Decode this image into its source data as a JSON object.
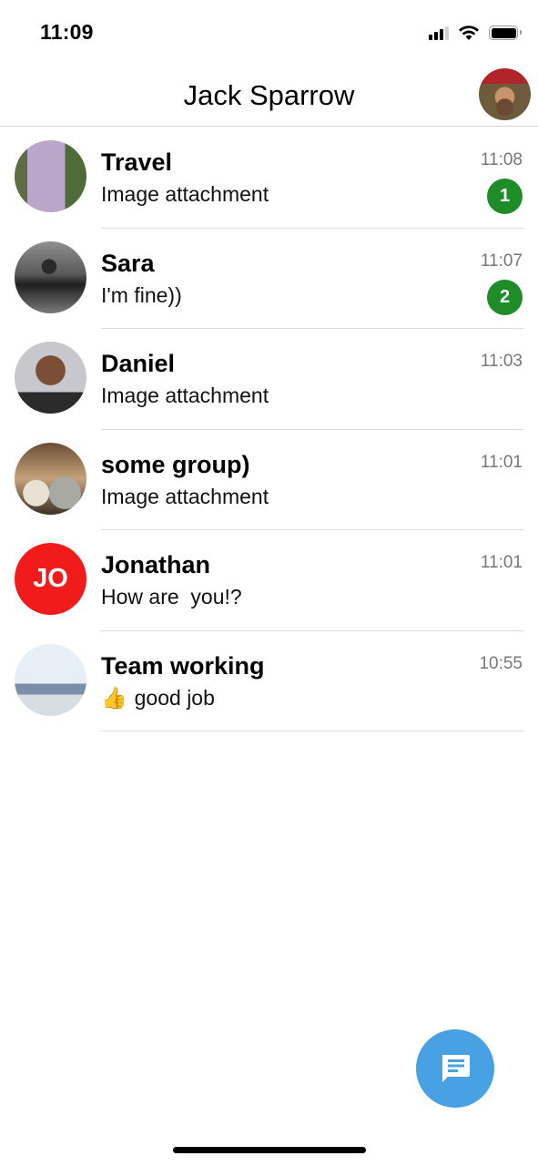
{
  "status_bar": {
    "time": "11:09",
    "icons": [
      "signal-icon",
      "wifi-icon",
      "battery-icon"
    ]
  },
  "header": {
    "title": "Jack Sparrow",
    "avatar": "user-avatar"
  },
  "chats": [
    {
      "name": "Travel",
      "preview": "Image attachment",
      "time": "11:08",
      "unread": "1",
      "avatar": "image"
    },
    {
      "name": "Sara",
      "preview": "I'm fine))",
      "time": "11:07",
      "unread": "2",
      "avatar": "image"
    },
    {
      "name": "Daniel",
      "preview": "Image attachment",
      "time": "11:03",
      "unread": null,
      "avatar": "image"
    },
    {
      "name": "some group)",
      "preview": "Image attachment",
      "time": "11:01",
      "unread": null,
      "avatar": "image"
    },
    {
      "name": "Jonathan",
      "preview": "How are  you!?",
      "time": "11:01",
      "unread": null,
      "avatar_initials": "JO",
      "avatar_color": "#f21b1b"
    },
    {
      "name": "Team working",
      "preview_emoji": "👍",
      "preview": "good job",
      "time": "10:55",
      "unread": null,
      "avatar": "image"
    }
  ],
  "fab": {
    "icon": "new-message-icon",
    "color": "#47a1e2"
  },
  "colors": {
    "unread_badge": "#1e8d27",
    "time_text": "#777777",
    "divider": "#dcdcdc"
  }
}
